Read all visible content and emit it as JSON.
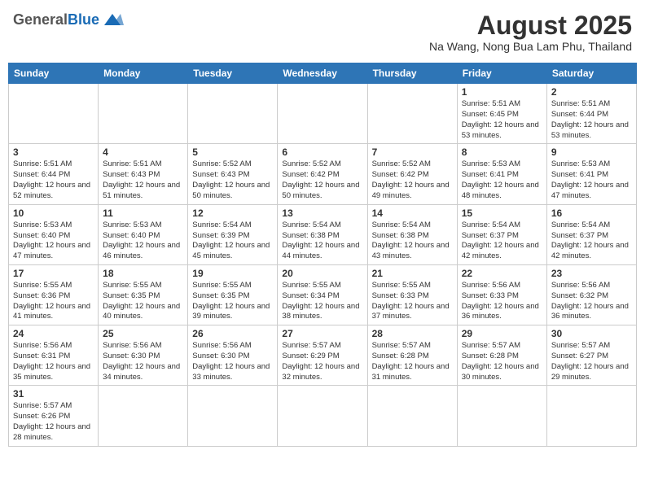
{
  "header": {
    "logo_general": "General",
    "logo_blue": "Blue",
    "month_title": "August 2025",
    "location": "Na Wang, Nong Bua Lam Phu, Thailand"
  },
  "days_of_week": [
    "Sunday",
    "Monday",
    "Tuesday",
    "Wednesday",
    "Thursday",
    "Friday",
    "Saturday"
  ],
  "weeks": [
    [
      {
        "day": "",
        "info": ""
      },
      {
        "day": "",
        "info": ""
      },
      {
        "day": "",
        "info": ""
      },
      {
        "day": "",
        "info": ""
      },
      {
        "day": "",
        "info": ""
      },
      {
        "day": "1",
        "info": "Sunrise: 5:51 AM\nSunset: 6:45 PM\nDaylight: 12 hours\nand 53 minutes."
      },
      {
        "day": "2",
        "info": "Sunrise: 5:51 AM\nSunset: 6:44 PM\nDaylight: 12 hours\nand 53 minutes."
      }
    ],
    [
      {
        "day": "3",
        "info": "Sunrise: 5:51 AM\nSunset: 6:44 PM\nDaylight: 12 hours\nand 52 minutes."
      },
      {
        "day": "4",
        "info": "Sunrise: 5:51 AM\nSunset: 6:43 PM\nDaylight: 12 hours\nand 51 minutes."
      },
      {
        "day": "5",
        "info": "Sunrise: 5:52 AM\nSunset: 6:43 PM\nDaylight: 12 hours\nand 50 minutes."
      },
      {
        "day": "6",
        "info": "Sunrise: 5:52 AM\nSunset: 6:42 PM\nDaylight: 12 hours\nand 50 minutes."
      },
      {
        "day": "7",
        "info": "Sunrise: 5:52 AM\nSunset: 6:42 PM\nDaylight: 12 hours\nand 49 minutes."
      },
      {
        "day": "8",
        "info": "Sunrise: 5:53 AM\nSunset: 6:41 PM\nDaylight: 12 hours\nand 48 minutes."
      },
      {
        "day": "9",
        "info": "Sunrise: 5:53 AM\nSunset: 6:41 PM\nDaylight: 12 hours\nand 47 minutes."
      }
    ],
    [
      {
        "day": "10",
        "info": "Sunrise: 5:53 AM\nSunset: 6:40 PM\nDaylight: 12 hours\nand 47 minutes."
      },
      {
        "day": "11",
        "info": "Sunrise: 5:53 AM\nSunset: 6:40 PM\nDaylight: 12 hours\nand 46 minutes."
      },
      {
        "day": "12",
        "info": "Sunrise: 5:54 AM\nSunset: 6:39 PM\nDaylight: 12 hours\nand 45 minutes."
      },
      {
        "day": "13",
        "info": "Sunrise: 5:54 AM\nSunset: 6:38 PM\nDaylight: 12 hours\nand 44 minutes."
      },
      {
        "day": "14",
        "info": "Sunrise: 5:54 AM\nSunset: 6:38 PM\nDaylight: 12 hours\nand 43 minutes."
      },
      {
        "day": "15",
        "info": "Sunrise: 5:54 AM\nSunset: 6:37 PM\nDaylight: 12 hours\nand 42 minutes."
      },
      {
        "day": "16",
        "info": "Sunrise: 5:54 AM\nSunset: 6:37 PM\nDaylight: 12 hours\nand 42 minutes."
      }
    ],
    [
      {
        "day": "17",
        "info": "Sunrise: 5:55 AM\nSunset: 6:36 PM\nDaylight: 12 hours\nand 41 minutes."
      },
      {
        "day": "18",
        "info": "Sunrise: 5:55 AM\nSunset: 6:35 PM\nDaylight: 12 hours\nand 40 minutes."
      },
      {
        "day": "19",
        "info": "Sunrise: 5:55 AM\nSunset: 6:35 PM\nDaylight: 12 hours\nand 39 minutes."
      },
      {
        "day": "20",
        "info": "Sunrise: 5:55 AM\nSunset: 6:34 PM\nDaylight: 12 hours\nand 38 minutes."
      },
      {
        "day": "21",
        "info": "Sunrise: 5:55 AM\nSunset: 6:33 PM\nDaylight: 12 hours\nand 37 minutes."
      },
      {
        "day": "22",
        "info": "Sunrise: 5:56 AM\nSunset: 6:33 PM\nDaylight: 12 hours\nand 36 minutes."
      },
      {
        "day": "23",
        "info": "Sunrise: 5:56 AM\nSunset: 6:32 PM\nDaylight: 12 hours\nand 36 minutes."
      }
    ],
    [
      {
        "day": "24",
        "info": "Sunrise: 5:56 AM\nSunset: 6:31 PM\nDaylight: 12 hours\nand 35 minutes."
      },
      {
        "day": "25",
        "info": "Sunrise: 5:56 AM\nSunset: 6:30 PM\nDaylight: 12 hours\nand 34 minutes."
      },
      {
        "day": "26",
        "info": "Sunrise: 5:56 AM\nSunset: 6:30 PM\nDaylight: 12 hours\nand 33 minutes."
      },
      {
        "day": "27",
        "info": "Sunrise: 5:57 AM\nSunset: 6:29 PM\nDaylight: 12 hours\nand 32 minutes."
      },
      {
        "day": "28",
        "info": "Sunrise: 5:57 AM\nSunset: 6:28 PM\nDaylight: 12 hours\nand 31 minutes."
      },
      {
        "day": "29",
        "info": "Sunrise: 5:57 AM\nSunset: 6:28 PM\nDaylight: 12 hours\nand 30 minutes."
      },
      {
        "day": "30",
        "info": "Sunrise: 5:57 AM\nSunset: 6:27 PM\nDaylight: 12 hours\nand 29 minutes."
      }
    ],
    [
      {
        "day": "31",
        "info": "Sunrise: 5:57 AM\nSunset: 6:26 PM\nDaylight: 12 hours\nand 28 minutes."
      },
      {
        "day": "",
        "info": ""
      },
      {
        "day": "",
        "info": ""
      },
      {
        "day": "",
        "info": ""
      },
      {
        "day": "",
        "info": ""
      },
      {
        "day": "",
        "info": ""
      },
      {
        "day": "",
        "info": ""
      }
    ]
  ]
}
